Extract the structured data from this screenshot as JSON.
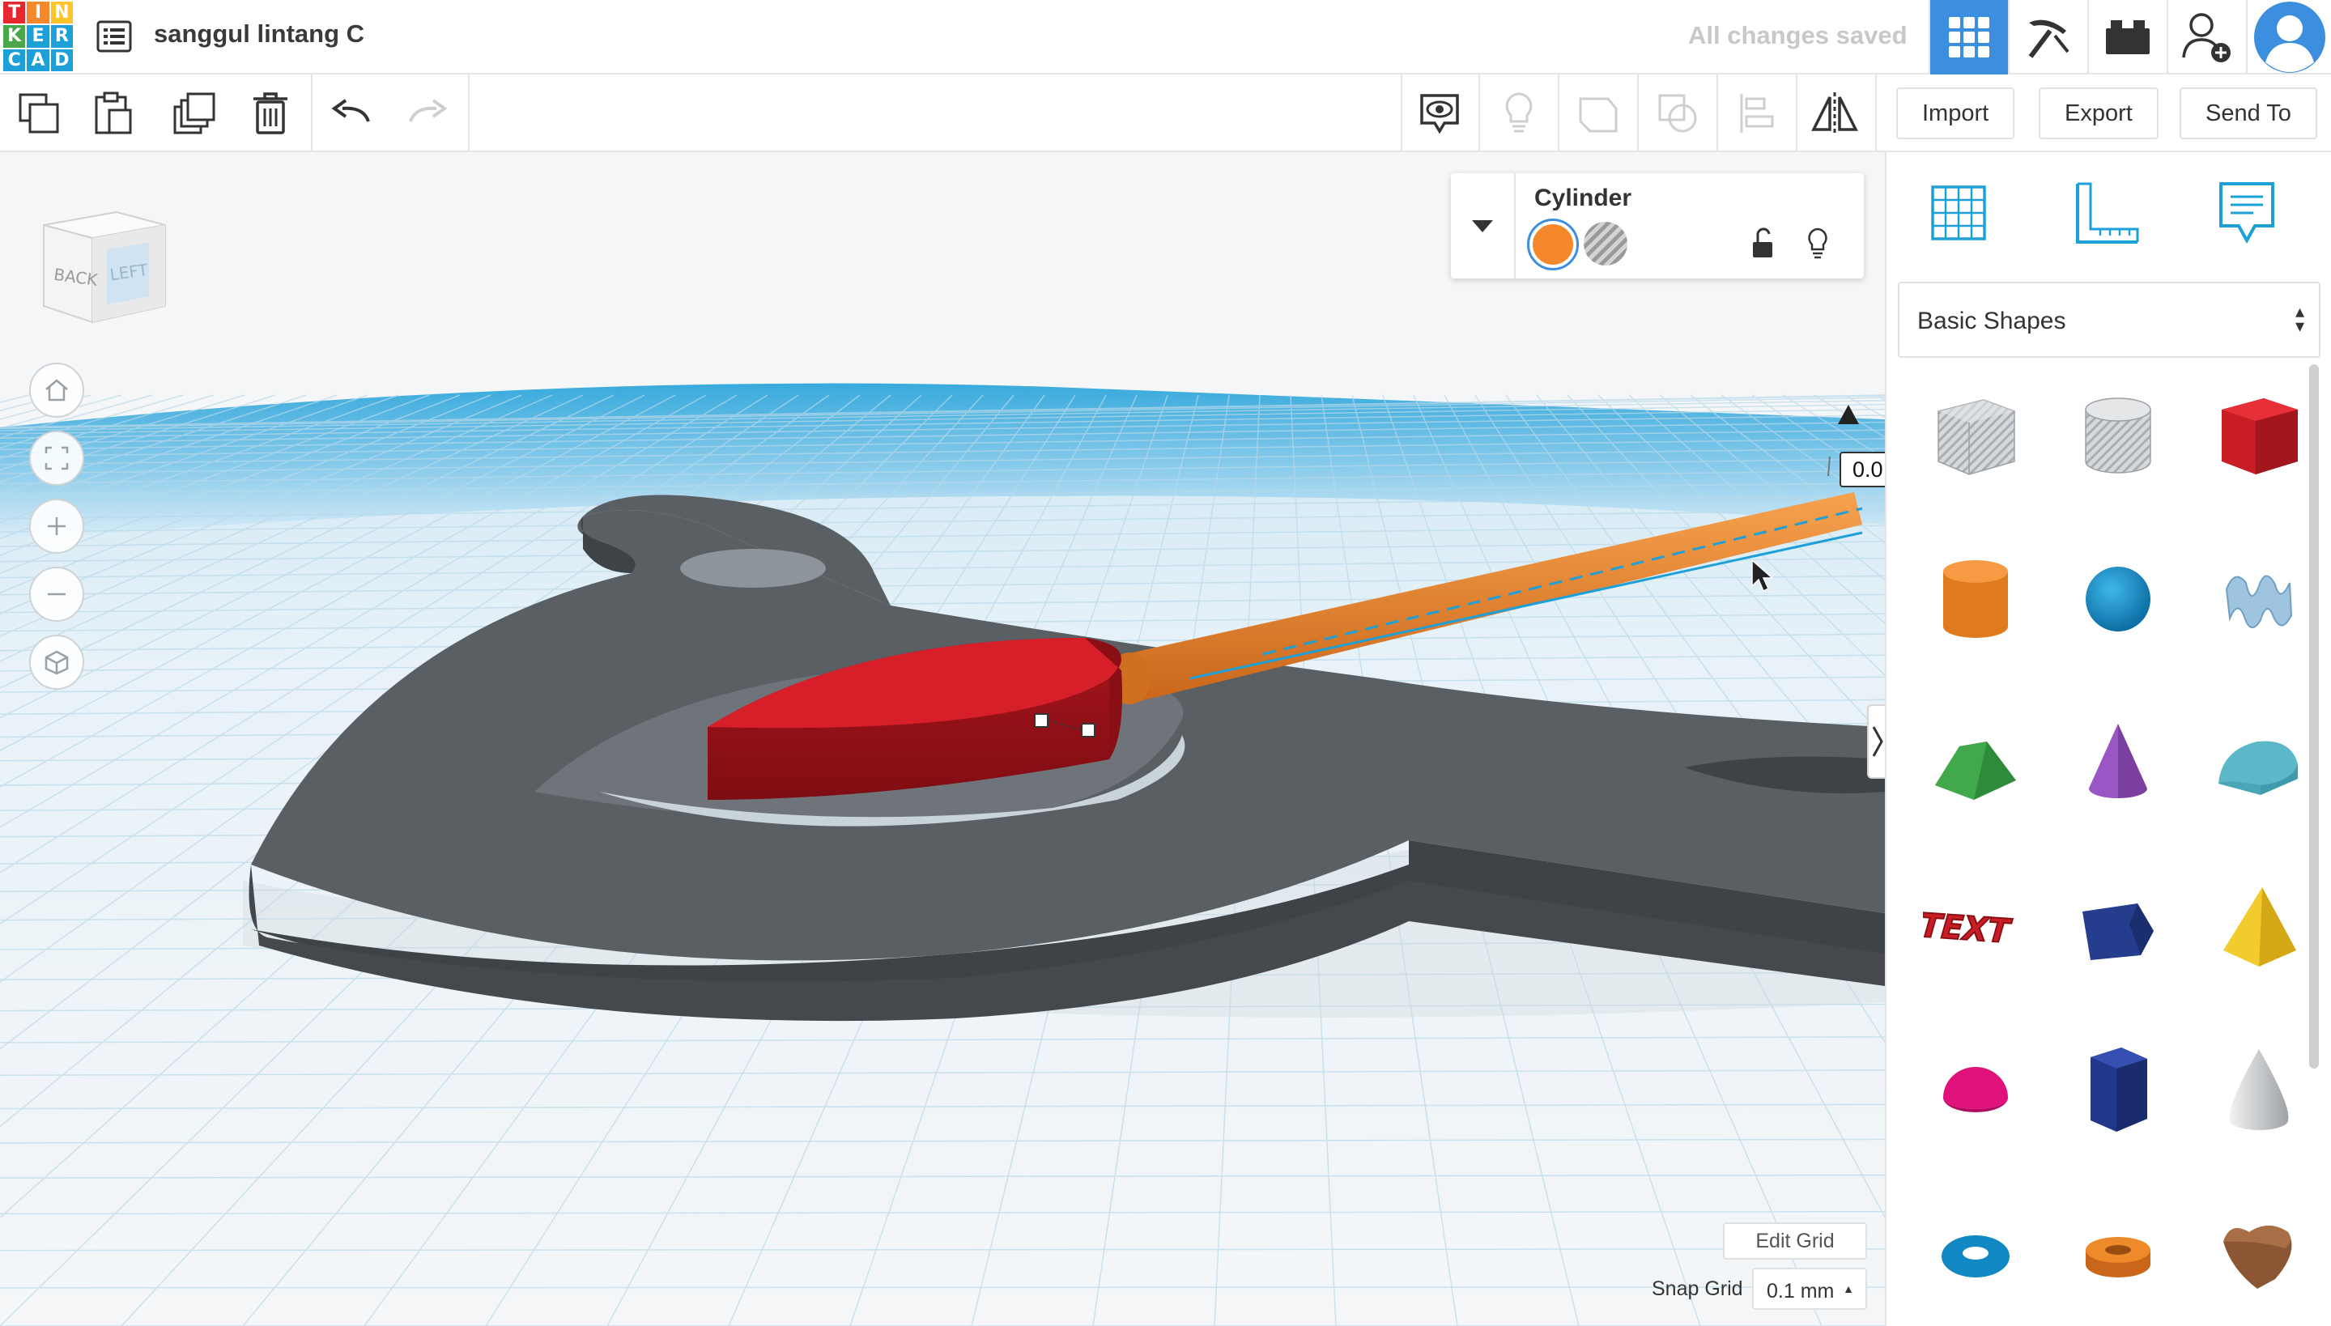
{
  "header": {
    "logo_letters": [
      "T",
      "I",
      "N",
      "K",
      "E",
      "R",
      "C",
      "A",
      "D"
    ],
    "logo_colors": [
      "#e6272f",
      "#f5882a",
      "#fdc52a",
      "#4aa84a",
      "#1d9fd8",
      "#1d9fd8",
      "#1d9fd8",
      "#1d9fd8",
      "#1d9fd8"
    ],
    "design_title": "sanggul lintang C",
    "save_status": "All changes saved"
  },
  "toolbar": {
    "import_label": "Import",
    "export_label": "Export",
    "send_to_label": "Send To"
  },
  "inspector": {
    "shape_name": "Cylinder",
    "solid_color": "#f5882a"
  },
  "viewport": {
    "view_cube_back": "BACK",
    "view_cube_left": "LEFT",
    "dimension_value": "0.0",
    "edit_grid_label": "Edit Grid",
    "snap_grid_label": "Snap Grid",
    "snap_grid_value": "0.1 mm"
  },
  "panel": {
    "category": "Basic Shapes",
    "shapes": [
      "box-hole",
      "cylinder-hole",
      "box",
      "cylinder",
      "sphere",
      "scribble",
      "roof",
      "cone",
      "round-roof",
      "text",
      "diamond",
      "pyramid",
      "half-sphere",
      "polygon",
      "paraboloid",
      "torus",
      "tube",
      "heart"
    ],
    "text_shape_label": "TEXT"
  },
  "colors": {
    "accent": "#3c8fde",
    "workplane_blue": "#1d9fd8",
    "shape_dark": "#4e5358",
    "shape_red": "#d61f29",
    "shape_orange": "#f5882a"
  }
}
